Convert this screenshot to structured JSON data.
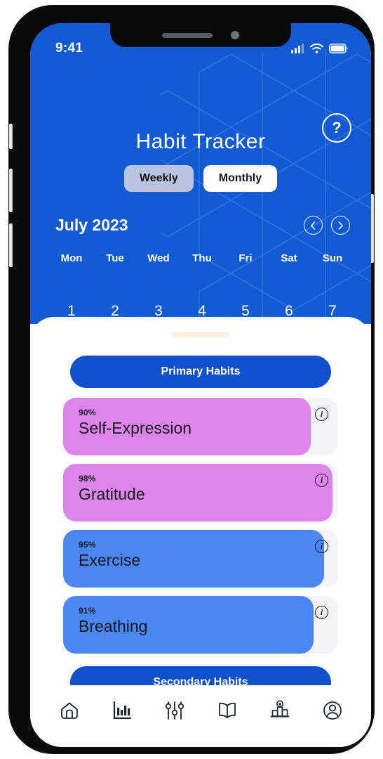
{
  "status_bar": {
    "time": "9:41",
    "icons": [
      "cellular-signal-icon",
      "wifi-icon",
      "battery-icon"
    ]
  },
  "header": {
    "title": "Habit Tracker",
    "help_label": "?",
    "help_icon": "question-mark-icon",
    "background_color": "#1259d4",
    "pattern": "hexagon-pattern"
  },
  "view_toggle": {
    "options": [
      {
        "label": "Weekly",
        "active": true
      },
      {
        "label": "Monthly",
        "active": false
      }
    ]
  },
  "calendar": {
    "month_label": "July 2023",
    "prev_icon": "chevron-left-icon",
    "next_icon": "chevron-right-icon",
    "weekdays": [
      "Mon",
      "Tue",
      "Wed",
      "Thu",
      "Fri",
      "Sat",
      "Sun"
    ],
    "dates": [
      "1",
      "2",
      "3",
      "4",
      "5",
      "6",
      "7"
    ]
  },
  "sheet": {
    "drag_handle": "drag-handle",
    "primary_section_label": "Primary Habits",
    "secondary_section_label": "Secondary Habits",
    "habits": [
      {
        "name": "Self-Expression",
        "percent": "90%",
        "value": 90,
        "color": "#dd85ea",
        "info_icon": "info-icon"
      },
      {
        "name": "Gratitude",
        "percent": "98%",
        "value": 98,
        "color": "#dd85ea",
        "info_icon": "info-icon"
      },
      {
        "name": "Exercise",
        "percent": "95%",
        "value": 95,
        "color": "#4b87f2",
        "info_icon": "info-icon"
      },
      {
        "name": "Breathing",
        "percent": "91%",
        "value": 91,
        "color": "#4b87f2",
        "info_icon": "info-icon"
      }
    ]
  },
  "bottom_nav": {
    "items": [
      {
        "icon": "home-icon",
        "label": "Home",
        "active": false
      },
      {
        "icon": "bar-chart-icon",
        "label": "Statistics",
        "active": true
      },
      {
        "icon": "sliders-icon",
        "label": "Settings",
        "active": false
      },
      {
        "icon": "book-icon",
        "label": "Journal",
        "active": false
      },
      {
        "icon": "podium-icon",
        "label": "Leaderboard",
        "active": false
      },
      {
        "icon": "profile-icon",
        "label": "Profile",
        "active": false
      }
    ]
  },
  "colors": {
    "brand_blue": "#1259d4",
    "section_blue": "#1050cc",
    "habit_pink": "#dd85ea",
    "habit_blue": "#4b87f2",
    "track_gray": "#f4f4f6",
    "toggle_active": "#b9c3e2",
    "nav_icon": "#1c2733"
  }
}
